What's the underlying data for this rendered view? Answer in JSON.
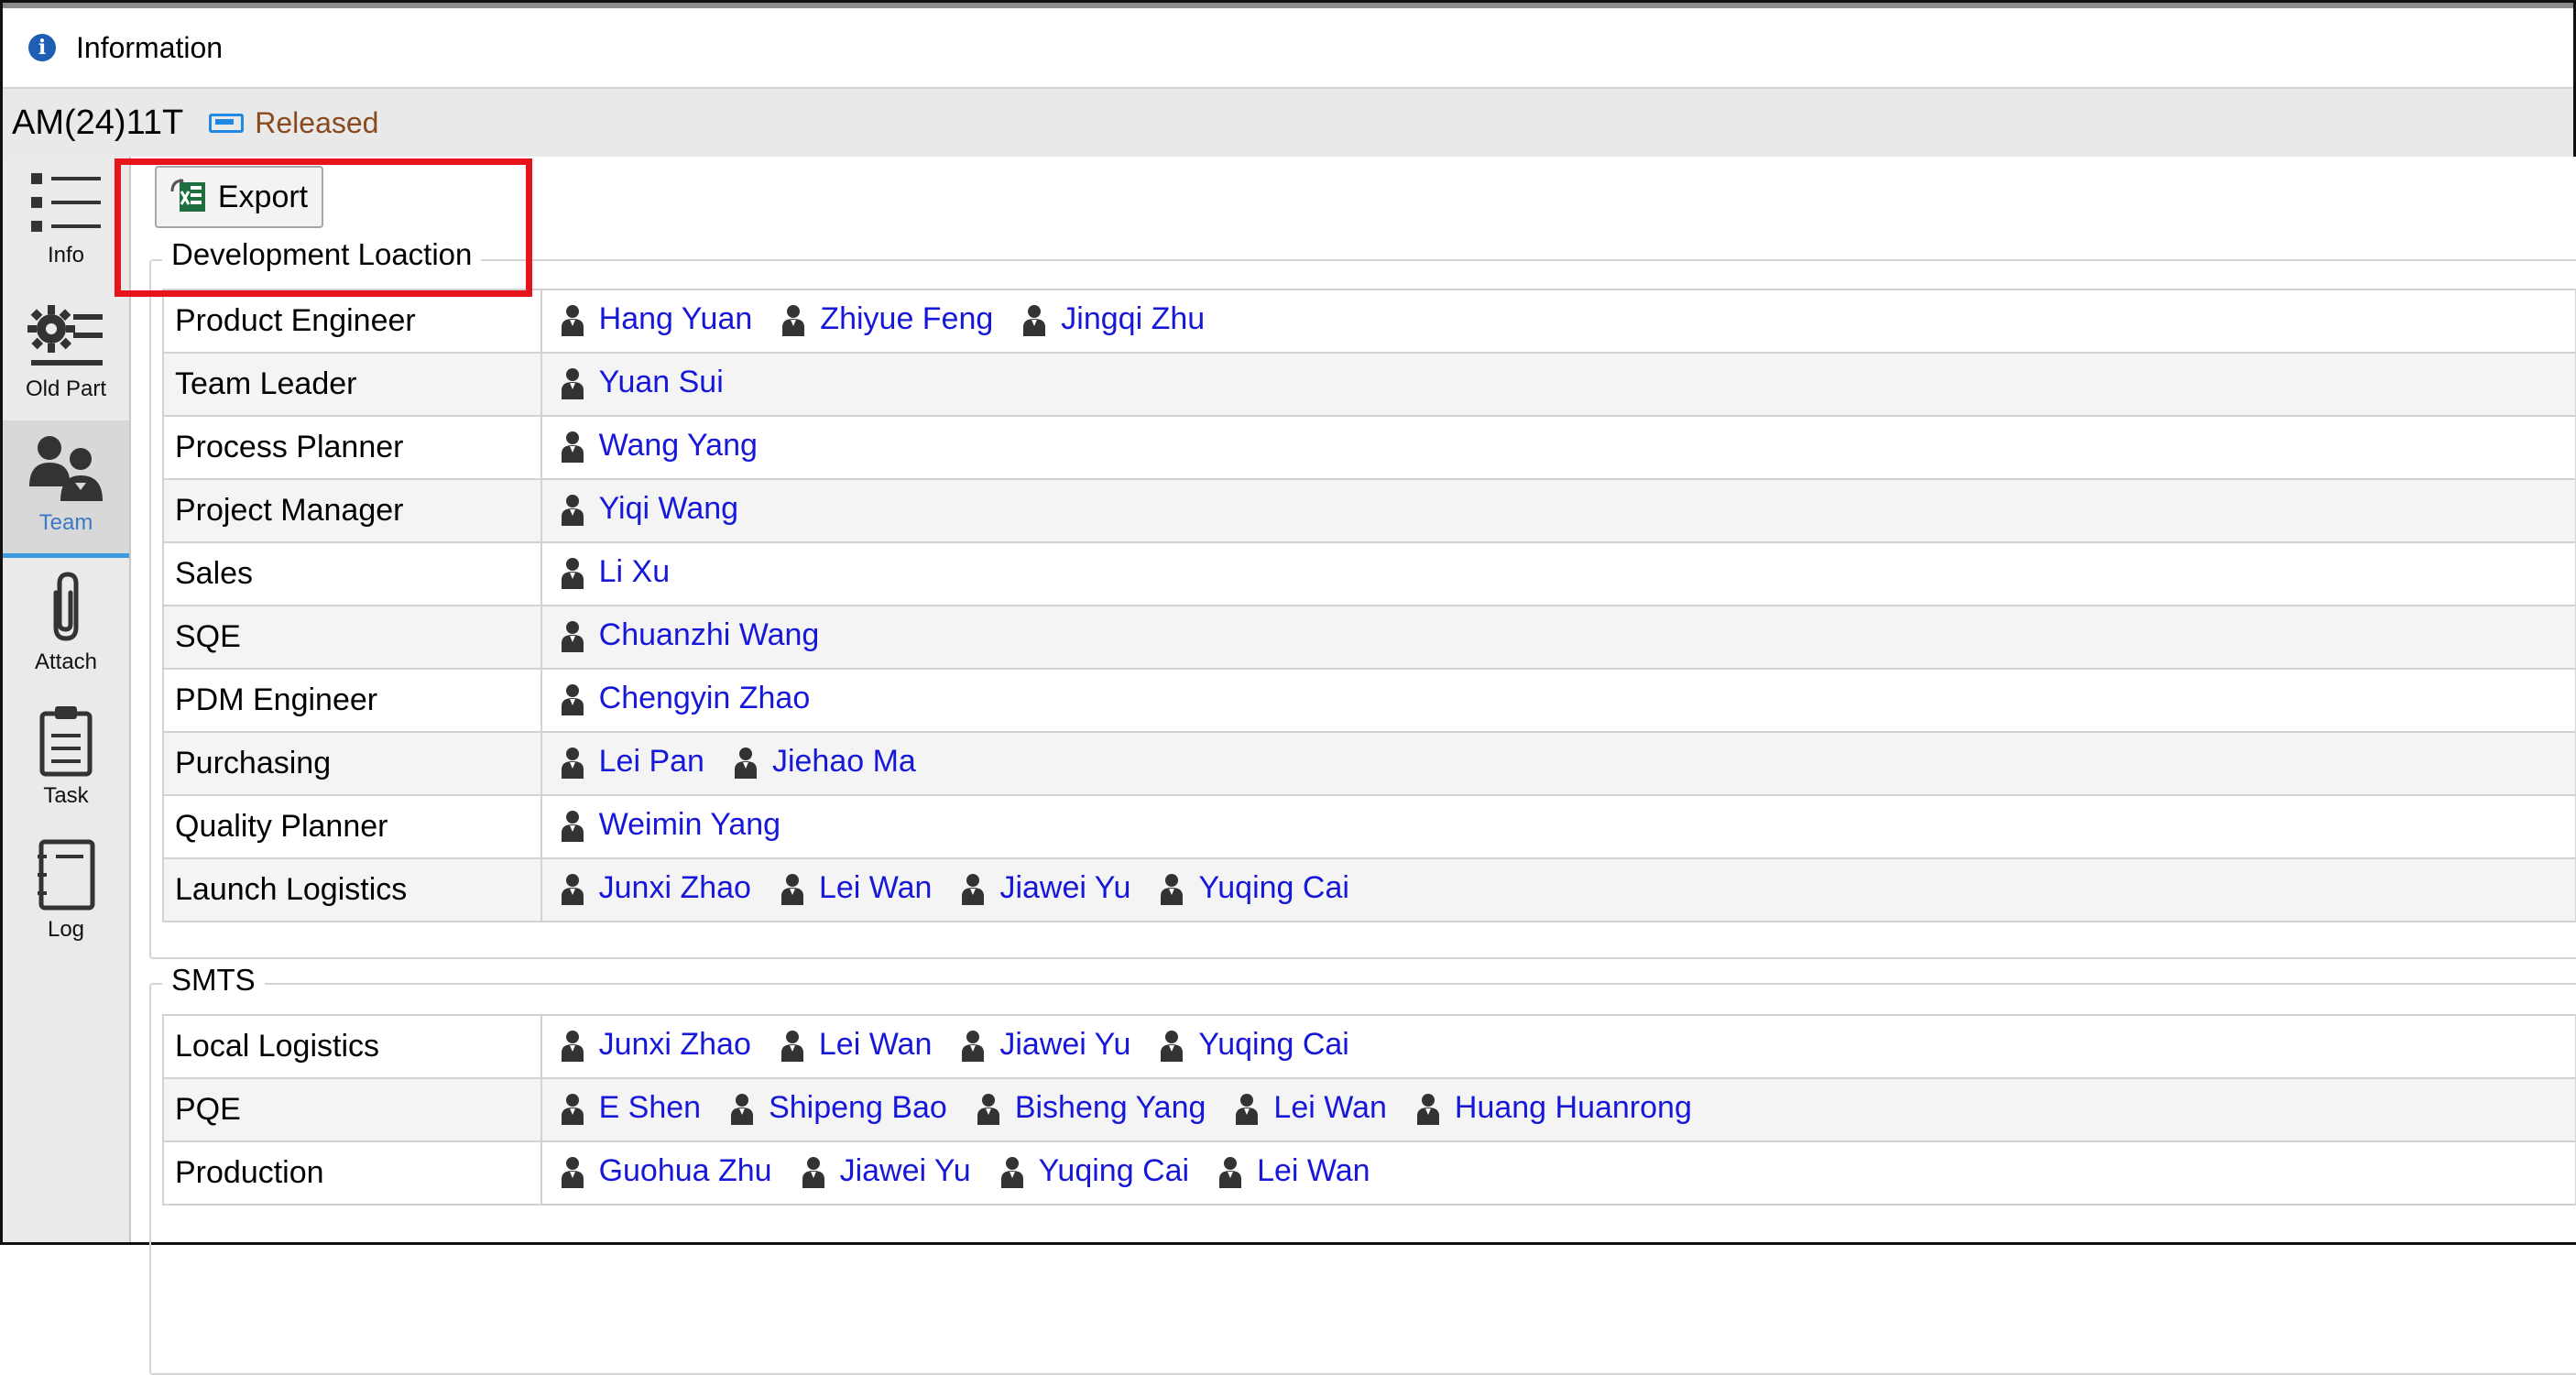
{
  "window": {
    "title": "Information",
    "info_icon": "info-icon"
  },
  "document": {
    "id": "AM(24)11T",
    "status": "Released",
    "status_color": "#8a4a1f"
  },
  "sidebar": {
    "items": [
      {
        "label": "Info",
        "icon": "list-icon",
        "active": false
      },
      {
        "label": "Old Part",
        "icon": "gear-list-icon",
        "active": false
      },
      {
        "label": "Team",
        "icon": "team-icon",
        "active": true
      },
      {
        "label": "Attach",
        "icon": "paperclip-icon",
        "active": false
      },
      {
        "label": "Task",
        "icon": "clipboard-icon",
        "active": false
      },
      {
        "label": "Log",
        "icon": "notebook-icon",
        "active": false
      }
    ]
  },
  "toolbar": {
    "export_label": "Export",
    "export_icon": "excel-icon"
  },
  "sections": [
    {
      "title": "Development Loaction",
      "rows": [
        {
          "role": "Product Engineer",
          "members": [
            "Hang Yuan",
            "Zhiyue Feng",
            "Jingqi Zhu"
          ]
        },
        {
          "role": "Team Leader",
          "members": [
            "Yuan Sui"
          ]
        },
        {
          "role": "Process Planner",
          "members": [
            "Wang Yang"
          ]
        },
        {
          "role": "Project Manager",
          "members": [
            "Yiqi Wang"
          ]
        },
        {
          "role": "Sales",
          "members": [
            "Li Xu"
          ]
        },
        {
          "role": "SQE",
          "members": [
            "Chuanzhi Wang"
          ]
        },
        {
          "role": "PDM Engineer",
          "members": [
            "Chengyin Zhao"
          ]
        },
        {
          "role": "Purchasing",
          "members": [
            "Lei Pan",
            "Jiehao Ma"
          ]
        },
        {
          "role": "Quality Planner",
          "members": [
            "Weimin Yang"
          ]
        },
        {
          "role": "Launch Logistics",
          "members": [
            "Junxi Zhao",
            "Lei Wan",
            "Jiawei Yu",
            "Yuqing Cai"
          ]
        }
      ]
    },
    {
      "title": "SMTS",
      "rows": [
        {
          "role": "Local Logistics",
          "members": [
            "Junxi Zhao",
            "Lei Wan",
            "Jiawei Yu",
            "Yuqing Cai"
          ]
        },
        {
          "role": "PQE",
          "members": [
            "E Shen",
            "Shipeng Bao",
            "Bisheng Yang",
            "Lei Wan",
            "Huang Huanrong"
          ]
        },
        {
          "role": "Production",
          "members": [
            "Guohua Zhu",
            "Jiawei Yu",
            "Yuqing Cai",
            "Lei Wan"
          ]
        }
      ]
    }
  ],
  "colors": {
    "link": "#1717d9",
    "highlight": "#e8141c",
    "accent": "#3b79c6"
  }
}
